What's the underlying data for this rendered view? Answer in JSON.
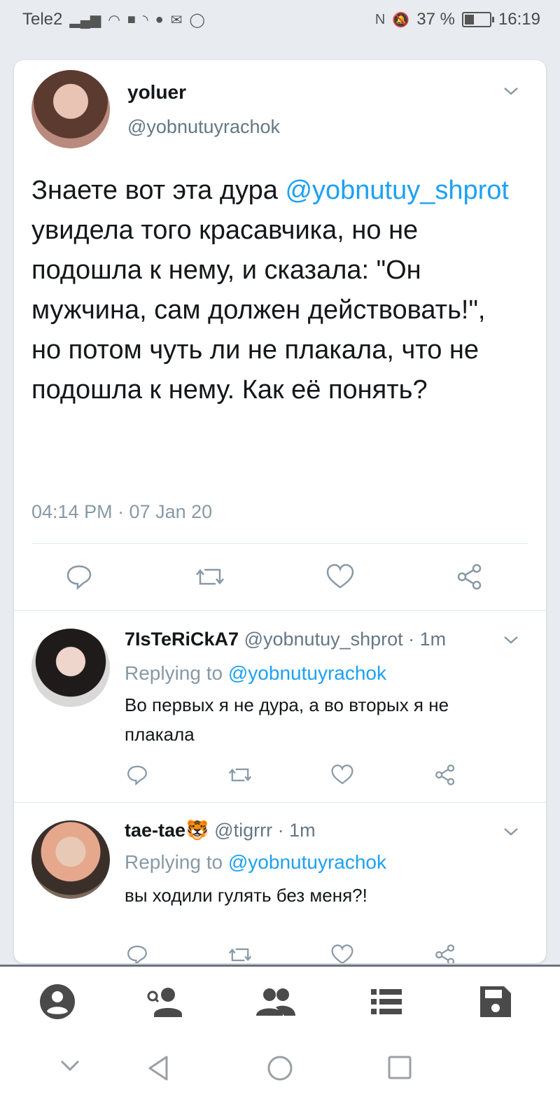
{
  "status_bar": {
    "carrier": "Tele2",
    "battery": "37 %",
    "battery_level": 0.37,
    "time": "16:19"
  },
  "main_tweet": {
    "name": "yoluer",
    "handle": "@yobnutuyrachok",
    "text_before": "Знаете вот эта дура ",
    "mention": "@yobnutuy_shprot",
    "text_after": " увидела того красавчика, но не подошла к нему, и сказала: \"Он мужчина, сам должен действовать!\", но потом чуть ли не плакала, что не подошла к нему. Как её понять?",
    "timestamp": "04:14 PM · 07 Jan 20"
  },
  "replies": [
    {
      "name": "7IsTeRiCkA7",
      "handle_time": "@yobnutuy_shprot · 1m",
      "replying_prefix": "Replying to ",
      "replying_to": "@yobnutuyrachok",
      "text": "Во первых я не дура, а во вторых я не плакала"
    },
    {
      "name": "tae-tae🐯",
      "handle_time": "@tigrrr · 1m",
      "replying_prefix": "Replying to ",
      "replying_to": "@yobnutuyrachok",
      "text": "вы ходили гулять без меня?!"
    }
  ],
  "icons": {
    "actions": [
      "reply-icon",
      "retweet-icon",
      "like-icon",
      "share-icon"
    ],
    "nav": [
      "profile-icon",
      "find-user-icon",
      "group-icon",
      "list-icon",
      "save-icon"
    ],
    "system": [
      "down-chevron-icon",
      "back-icon",
      "home-icon",
      "recents-icon"
    ]
  },
  "colors": {
    "link": "#1da1f2",
    "text": "#14171a",
    "muted": "#8899a6",
    "nav_icon": "#4a4a4a"
  }
}
